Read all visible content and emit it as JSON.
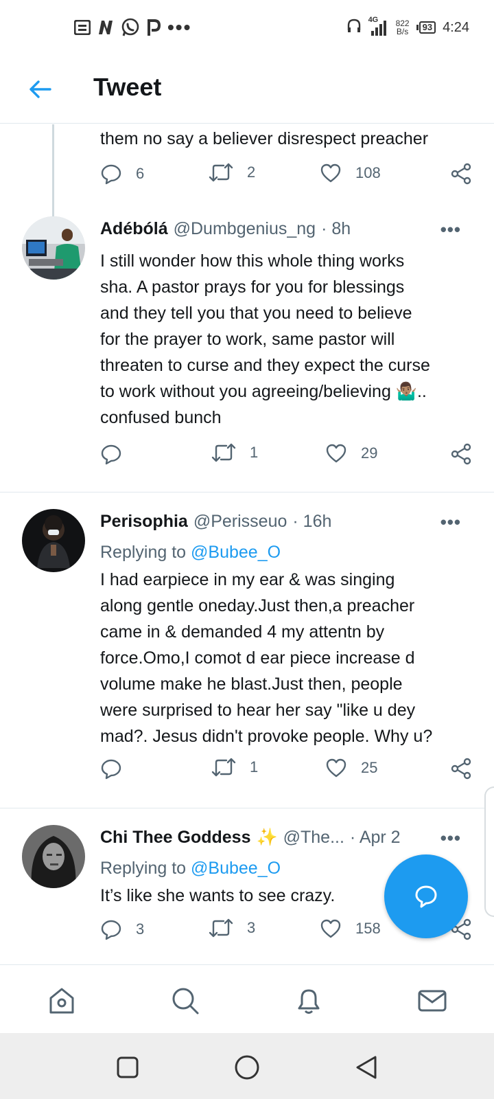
{
  "status_bar": {
    "left_icons": [
      "notes-icon",
      "n-app-icon",
      "whatsapp-icon",
      "p-app-icon"
    ],
    "more": "•••",
    "network": "4G",
    "speed_value": "822",
    "speed_unit": "B/s",
    "battery": "93",
    "time": "4:24"
  },
  "header": {
    "title": "Tweet"
  },
  "previous_tweet": {
    "text": "them no say a believer disrespect preacher",
    "replies": "6",
    "retweets": "2",
    "likes": "108"
  },
  "tweets": [
    {
      "name": "Adébólá",
      "handle": "@Dumbgenius_ng",
      "time": "· 8h",
      "text_lines": [
        "I still wonder how this whole thing works",
        "sha. A pastor prays for you for blessings",
        "and they tell you that you need to believe",
        "for the prayer to work, same pastor will",
        "threaten to curse and they expect the curse",
        "to work without you agreeing/believing 🤷🏽‍♂️..",
        "confused bunch"
      ],
      "replies": "",
      "retweets": "1",
      "likes": "29"
    },
    {
      "name": "Perisophia",
      "handle": "@Perisseuo",
      "time": "· 16h",
      "replying_prefix": "Replying to",
      "replying_to": "@Bubee_O",
      "text_lines": [
        "I had earpiece in my ear & was singing",
        "along gentle oneday.Just then,a preacher",
        "came in & demanded 4 my attentn by",
        "force.Omo,I comot d ear piece increase d",
        "volume make he blast.Just then, people",
        "were surprised to hear her say \"like u dey",
        "mad?. Jesus didn't provoke people. Why u?"
      ],
      "replies": "",
      "retweets": "1",
      "likes": "25"
    },
    {
      "name": "Chi Thee Goddess",
      "sparkle": "✨",
      "handle": "@The...",
      "time": "· Apr 2",
      "replying_prefix": "Replying to",
      "replying_to": "@Bubee_O",
      "text_lines": [
        "It’s like she wants to see crazy."
      ],
      "replies": "3",
      "retweets": "3",
      "likes": "158"
    }
  ],
  "more_label": "•••",
  "tab_bar": [
    "home-icon",
    "search-icon",
    "notifications-icon",
    "messages-icon"
  ],
  "colors": {
    "accent": "#1d9bf0",
    "text": "#14171a",
    "secondary": "#536471",
    "divider": "#e1e8ed"
  }
}
